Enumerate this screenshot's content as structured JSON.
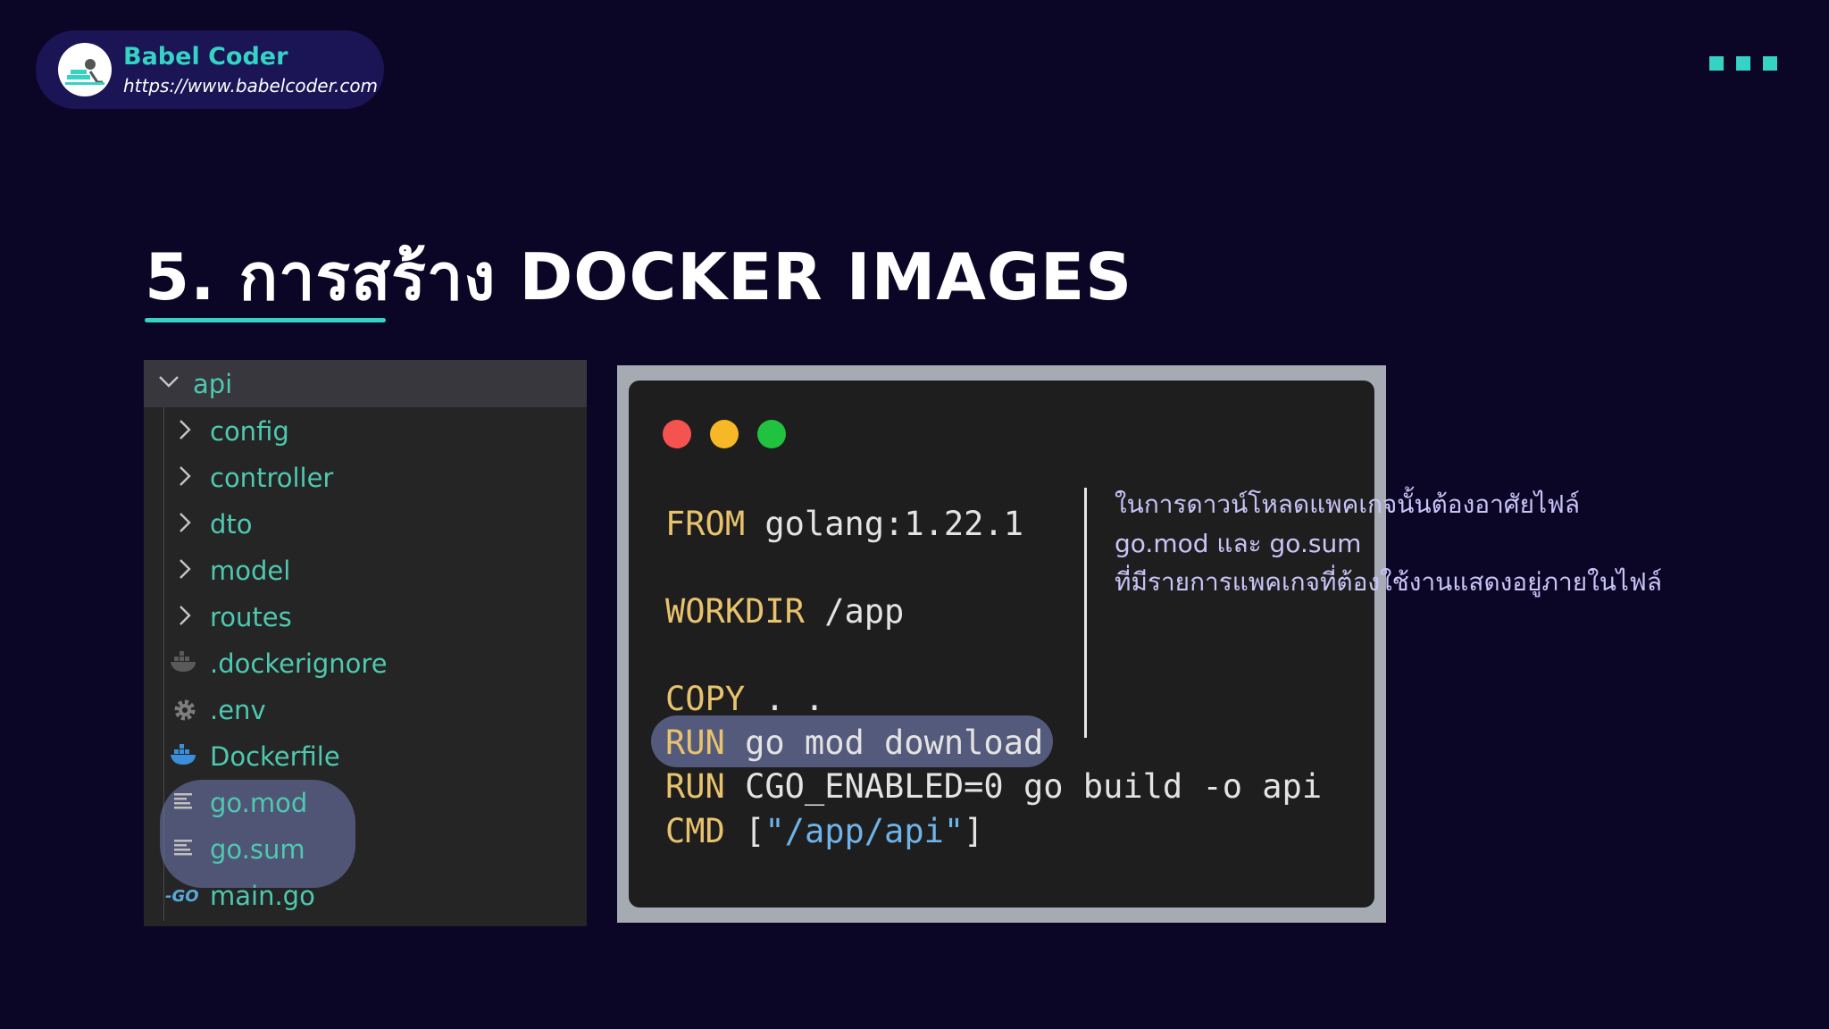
{
  "brand": {
    "name": "Babel Coder",
    "url": "https://www.babelcoder.com"
  },
  "slide": {
    "title": "5. การสร้าง DOCKER IMAGES"
  },
  "file_tree": {
    "root": "api",
    "items": [
      {
        "label": "config",
        "icon": "chevron-right-icon"
      },
      {
        "label": "controller",
        "icon": "chevron-right-icon"
      },
      {
        "label": "dto",
        "icon": "chevron-right-icon"
      },
      {
        "label": "model",
        "icon": "chevron-right-icon"
      },
      {
        "label": "routes",
        "icon": "chevron-right-icon"
      },
      {
        "label": ".dockerignore",
        "icon": "docker-icon"
      },
      {
        "label": ".env",
        "icon": "gear-icon"
      },
      {
        "label": "Dockerfile",
        "icon": "docker-icon"
      },
      {
        "label": "go.mod",
        "icon": "lines-icon"
      },
      {
        "label": "go.sum",
        "icon": "lines-icon"
      },
      {
        "label": "main.go",
        "icon": "go-icon"
      }
    ]
  },
  "dockerfile": {
    "from_kw": "FROM",
    "from_arg": " golang:1.22.1",
    "workdir_kw": "WORKDIR",
    "workdir_arg": " /app",
    "copy_kw": "COPY",
    "copy_arg": " . .",
    "run1_kw": "RUN",
    "run1_arg": " go mod download",
    "run2_kw": "RUN",
    "run2_arg": " CGO_ENABLED=0 go build -o api",
    "cmd_kw": "CMD",
    "cmd_open": " [",
    "cmd_str": "\"/app/api\"",
    "cmd_close": "]"
  },
  "explanation": {
    "line1": "ในการดาวน์โหลดแพคเกจนั้นต้องอาศัยไฟล์",
    "line2": "go.mod และ go.sum",
    "line3": "ที่มีรายการแพคเกจที่ต้องใช้งานแสดงอยู่ภายในไฟล์"
  },
  "colors": {
    "background": "#0c0626",
    "accent": "#34d3c4",
    "tree_text": "#4ec9b0",
    "keyword": "#e8c26c",
    "string": "#6fb3e8",
    "explanation_text": "#c9c4f7"
  }
}
